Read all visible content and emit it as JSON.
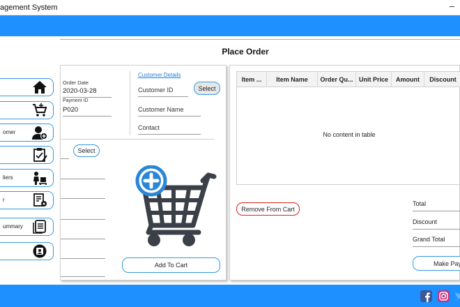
{
  "window": {
    "title": "agement System",
    "minimize": "–"
  },
  "sidebar": {
    "items": [
      {
        "label": "",
        "icon": "home-icon"
      },
      {
        "label": "",
        "icon": "cart-icon"
      },
      {
        "label": "omer",
        "icon": "add-user-icon"
      },
      {
        "label": "",
        "icon": "clipboard-check-icon"
      },
      {
        "label": "liers",
        "icon": "supplier-icon"
      },
      {
        "label": "r",
        "icon": "report-gear-icon"
      },
      {
        "label": "ummary",
        "icon": "summary-icon"
      },
      {
        "label": "",
        "icon": "contact-card-icon"
      }
    ]
  },
  "page": {
    "title": "Place Order"
  },
  "order": {
    "order_date_label": "Order Date",
    "order_date": "2020-03-28",
    "payment_id_label": "Payment ID",
    "payment_id": "P020"
  },
  "customer": {
    "details_link": "Customer Details",
    "id_label": "Customer ID",
    "select_label": "Select",
    "name_label": "Customer Name",
    "contact_label": "Contact"
  },
  "item": {
    "select_label": "Select",
    "add_to_cart_label": "Add To Cart"
  },
  "cart_table": {
    "columns": [
      "Item ...",
      "Item Name",
      "Order Qu...",
      "Unit Price",
      "Amount",
      "Discount"
    ],
    "empty_message": "No content in table"
  },
  "cart_actions": {
    "remove_label": "Remove From Cart",
    "make_payment_label": "Make Pay"
  },
  "totals": {
    "total_label": "Total",
    "discount_label": "Discount",
    "grand_total_label": "Grand Total"
  },
  "colors": {
    "brand_blue": "#1e90ff",
    "accent_red": "#e02020",
    "cart_dark": "#3b4048"
  }
}
